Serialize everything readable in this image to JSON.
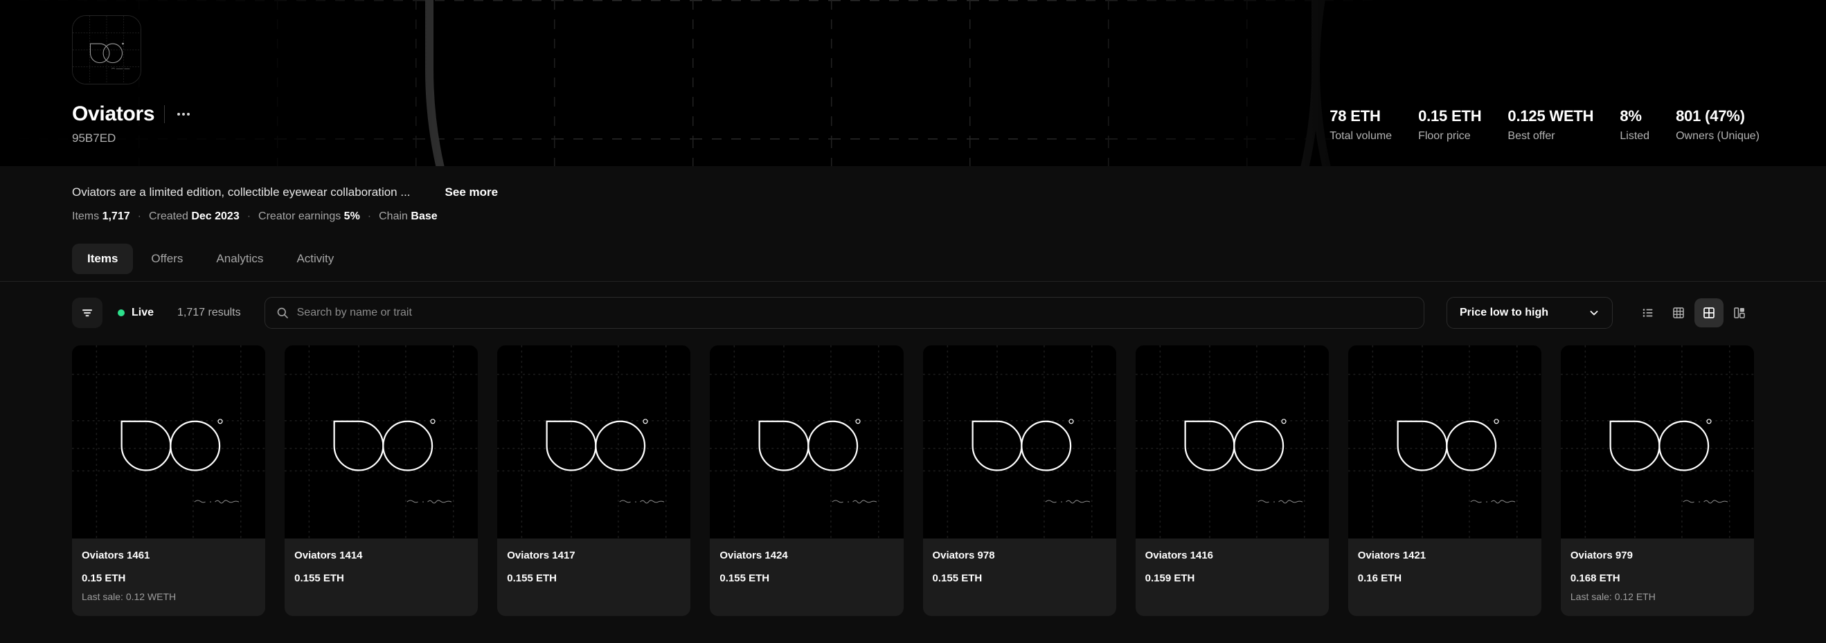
{
  "collection": {
    "name": "Oviators",
    "hash": "95B7ED",
    "more_menu_icon": "ellipsis-icon",
    "avatar_icon": "oviators-logo",
    "description": "Oviators are a limited edition, collectible eyewear collaboration ...",
    "see_more_label": "See more",
    "meta": [
      {
        "label": "Items",
        "value": "1,717"
      },
      {
        "label": "Created",
        "value": "Dec 2023"
      },
      {
        "label": "Creator earnings",
        "value": "5%"
      },
      {
        "label": "Chain",
        "value": "Base"
      }
    ]
  },
  "stats": [
    {
      "value": "78 ETH",
      "label": "Total volume"
    },
    {
      "value": "0.15 ETH",
      "label": "Floor price"
    },
    {
      "value": "0.125 WETH",
      "label": "Best offer"
    },
    {
      "value": "8%",
      "label": "Listed"
    },
    {
      "value": "801 (47%)",
      "label": "Owners (Unique)"
    }
  ],
  "tabs": [
    {
      "label": "Items",
      "active": true
    },
    {
      "label": "Offers",
      "active": false
    },
    {
      "label": "Analytics",
      "active": false
    },
    {
      "label": "Activity",
      "active": false
    }
  ],
  "toolbar": {
    "filter_icon": "filter-icon",
    "live_label": "Live",
    "live_dot_color": "#2de08c",
    "results_label": "1,717 results",
    "search_placeholder": "Search by name or trait",
    "search_value": "",
    "search_icon": "search-icon",
    "sort_value": "Price low to high",
    "sort_chevron_icon": "chevron-down-icon",
    "views": [
      {
        "name": "list-view",
        "icon": "list-icon",
        "active": false
      },
      {
        "name": "dense-grid-view",
        "icon": "grid-small-icon",
        "active": false
      },
      {
        "name": "grid-view",
        "icon": "grid-large-icon",
        "active": true
      },
      {
        "name": "gallery-view",
        "icon": "gallery-icon",
        "active": false
      }
    ]
  },
  "items": [
    {
      "name": "Oviators 1461",
      "price": "0.15 ETH",
      "last_sale": "Last sale: 0.12 WETH"
    },
    {
      "name": "Oviators 1414",
      "price": "0.155 ETH",
      "last_sale": ""
    },
    {
      "name": "Oviators 1417",
      "price": "0.155 ETH",
      "last_sale": ""
    },
    {
      "name": "Oviators 1424",
      "price": "0.155 ETH",
      "last_sale": ""
    },
    {
      "name": "Oviators 978",
      "price": "0.155 ETH",
      "last_sale": ""
    },
    {
      "name": "Oviators 1416",
      "price": "0.159 ETH",
      "last_sale": ""
    },
    {
      "name": "Oviators 1421",
      "price": "0.16 ETH",
      "last_sale": ""
    },
    {
      "name": "Oviators 979",
      "price": "0.168 ETH",
      "last_sale": "Last sale: 0.12 ETH"
    }
  ],
  "artwork": {
    "signature": "Salvia Amanti",
    "stroke_color": "#ffffff",
    "background_color": "#000000",
    "grid_color": "#1e1e1e"
  }
}
